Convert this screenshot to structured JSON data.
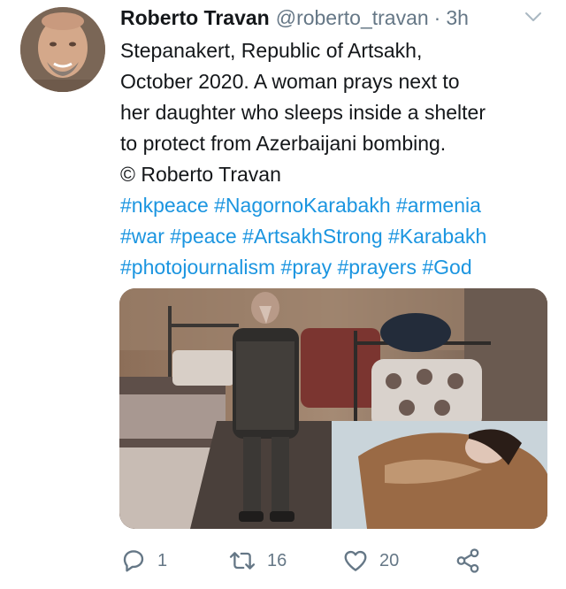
{
  "tweet": {
    "author_name": "Roberto Travan",
    "author_handle": "@roberto_travan",
    "separator": "·",
    "time": "3h",
    "text_lines": [
      "Stepanakert, Republic of Artsakh,",
      "October 2020. A woman prays next to",
      "her daughter who sleeps inside a shelter",
      "to protect from Azerbaijani bombing.",
      "© Roberto Travan"
    ],
    "hashtag_lines": [
      "#nkpeace #NagornoKarabakh #armenia",
      "#war #peace #ArtsakhStrong #Karabakh",
      "#photojournalism #pray #prayers #God"
    ],
    "hashtag_color": "#1b95e0"
  },
  "actions": {
    "reply_count": "1",
    "retweet_count": "16",
    "like_count": "20"
  },
  "icons": {
    "reply": "reply-icon",
    "retweet": "retweet-icon",
    "like": "heart-icon",
    "share": "share-icon",
    "menu": "chevron-down-icon"
  },
  "colors": {
    "text": "#14171a",
    "secondary": "#657786",
    "link": "#1b95e0"
  }
}
